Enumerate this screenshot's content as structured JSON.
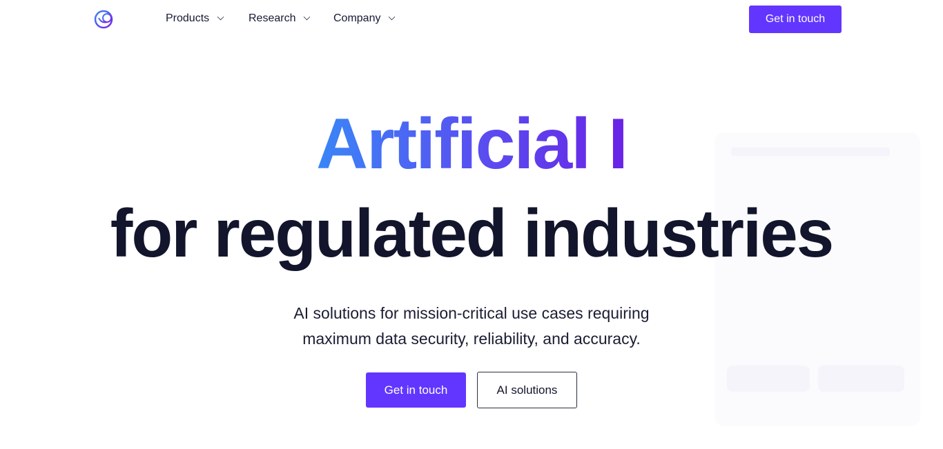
{
  "nav": {
    "logo": "company-logo",
    "items": [
      {
        "label": "Products"
      },
      {
        "label": "Research"
      },
      {
        "label": "Company"
      }
    ],
    "cta_label": "Get in touch"
  },
  "hero": {
    "title_line1": "Artificial I",
    "title_line2": "for regulated industries",
    "subtitle_line1": "AI solutions for mission-critical use cases requiring",
    "subtitle_line2": "maximum data security, reliability, and accuracy.",
    "primary_label": "Get in touch",
    "secondary_label": "AI solutions"
  },
  "colors": {
    "accent": "#6236ff",
    "gradient_start": "#3a86f7",
    "gradient_end": "#6a22e6",
    "text": "#12152b"
  }
}
